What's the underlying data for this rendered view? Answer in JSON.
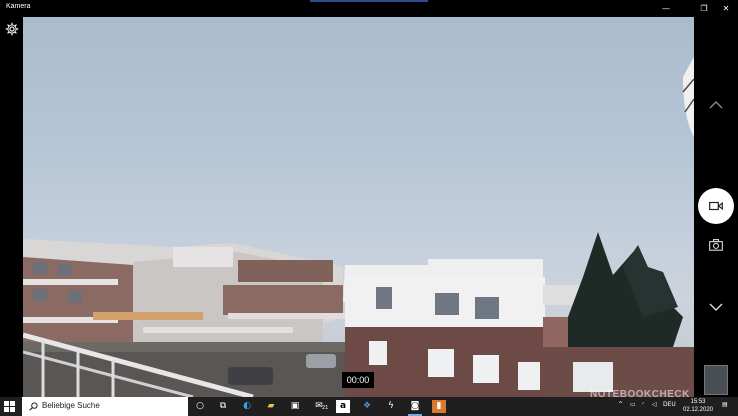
{
  "window": {
    "title": "Kamera",
    "minimize_glyph": "—",
    "maximize_glyph": "❐",
    "close_glyph": "✕"
  },
  "camera": {
    "timer": "00:00",
    "icons": [
      "settings-gear-icon",
      "chevron-up-icon",
      "video-camera-icon",
      "photo-camera-icon",
      "chevron-down-icon"
    ]
  },
  "taskbar": {
    "search_placeholder": "Beliebige Suche",
    "mail_badge": "21",
    "amazon_glyph": "a",
    "language": "DEU",
    "time": "15:53",
    "date": "02.12.2020"
  },
  "watermark": "NOTEBOOKCHECK",
  "colors": {
    "taskbar": "#1f1f1f",
    "accent": "#7aa7e6",
    "titlebar": "#000000"
  }
}
